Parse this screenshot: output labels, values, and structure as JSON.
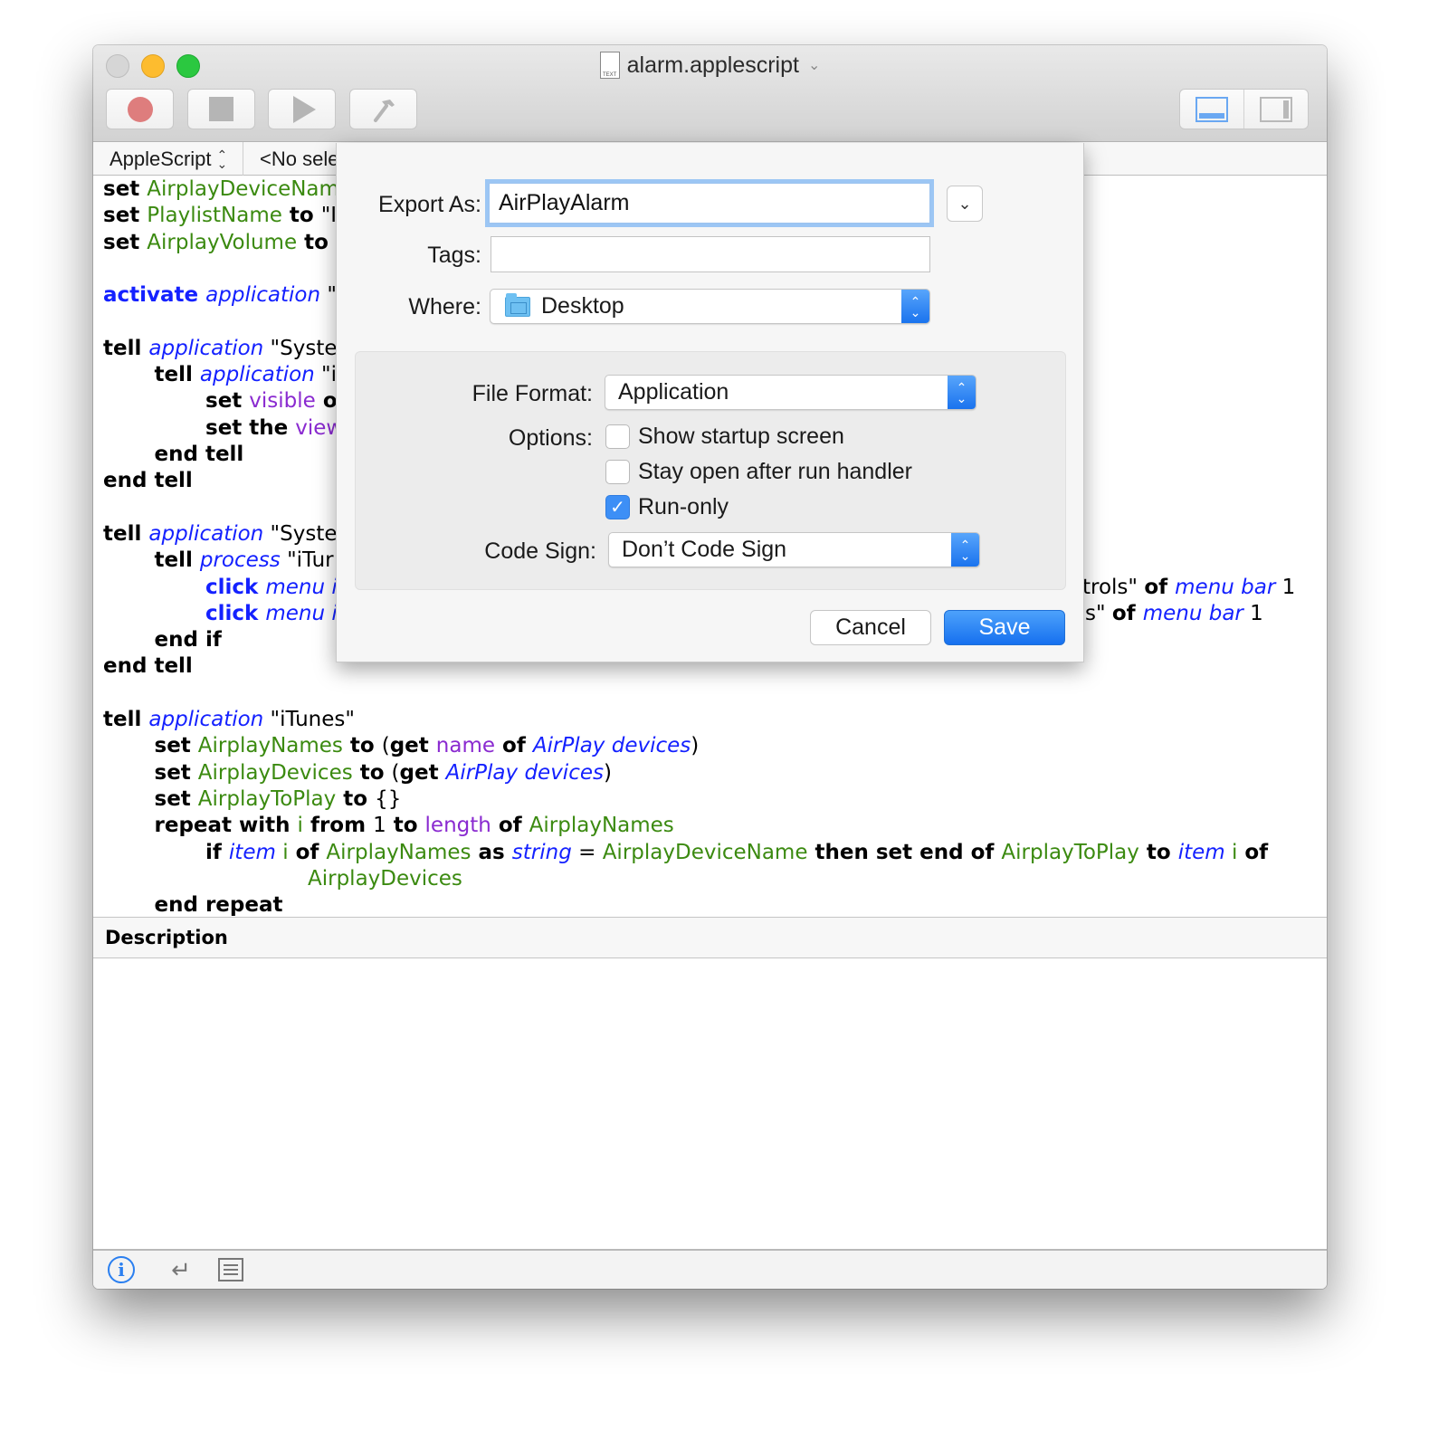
{
  "window": {
    "title": "alarm.applescript",
    "doc_icon_label": "TEXT",
    "title_chevron": "⌄"
  },
  "toolbar": {
    "record_icon": "record-icon",
    "stop_icon": "stop-icon",
    "run_icon": "play-icon",
    "compile_icon": "hammer-icon",
    "view_toggle": [
      "bottom-pane-icon",
      "side-pane-icon"
    ]
  },
  "navbar": {
    "language": "AppleScript",
    "selection": "<No sele",
    "updown": "⌃⌄"
  },
  "editor": {
    "lines": [
      [
        [
          "kw",
          "set "
        ],
        [
          "var",
          "AirplayDeviceNam"
        ]
      ],
      [
        [
          "kw",
          "set "
        ],
        [
          "var",
          "PlaylistName"
        ],
        [
          "kw",
          " to "
        ],
        [
          "str",
          "\"I"
        ]
      ],
      [
        [
          "kw",
          "set "
        ],
        [
          "var",
          "AirplayVolume"
        ],
        [
          "kw",
          " to"
        ]
      ],
      [],
      [
        [
          "cmd",
          "activate "
        ],
        [
          "app",
          "application"
        ],
        [
          "str",
          " \""
        ]
      ],
      [],
      [
        [
          "kw",
          "tell "
        ],
        [
          "app",
          "application"
        ],
        [
          "str",
          " \"Syste"
        ]
      ],
      [
        [
          "str",
          "\t"
        ],
        [
          "kw",
          "tell "
        ],
        [
          "app",
          "application"
        ],
        [
          "str",
          " \"i"
        ]
      ],
      [
        [
          "str",
          "\t\t"
        ],
        [
          "kw",
          "set "
        ],
        [
          "prop",
          "visible"
        ],
        [
          "kw",
          " o"
        ]
      ],
      [
        [
          "str",
          "\t\t"
        ],
        [
          "kw",
          "set the "
        ],
        [
          "prop",
          "view"
        ]
      ],
      [
        [
          "str",
          "\t"
        ],
        [
          "kw",
          "end tell"
        ]
      ],
      [
        [
          "kw",
          "end tell"
        ]
      ],
      [],
      [
        [
          "kw",
          "tell "
        ],
        [
          "app",
          "application"
        ],
        [
          "str",
          " \"Syste"
        ]
      ],
      [
        [
          "str",
          "\t"
        ],
        [
          "kw",
          "tell "
        ],
        [
          "app",
          "process"
        ],
        [
          "str",
          " \"iTur"
        ]
      ],
      [
        [
          "str",
          "\t\t"
        ],
        [
          "cmd",
          "click "
        ],
        [
          "app",
          "menu i"
        ]
      ],
      [
        [
          "str",
          "\t\t"
        ],
        [
          "cmd",
          "click "
        ],
        [
          "app",
          "menu i"
        ]
      ],
      [
        [
          "str",
          "\t"
        ],
        [
          "kw",
          "end if"
        ]
      ],
      [
        [
          "kw",
          "end tell"
        ]
      ],
      [],
      [
        [
          "kw",
          "tell "
        ],
        [
          "app",
          "application"
        ],
        [
          "str",
          " \"iTunes\""
        ]
      ],
      [
        [
          "str",
          "\t"
        ],
        [
          "kw",
          "set "
        ],
        [
          "var",
          "AirplayNames"
        ],
        [
          "kw",
          " to "
        ],
        [
          "str",
          "("
        ],
        [
          "kw",
          "get "
        ],
        [
          "prop",
          "name"
        ],
        [
          "kw",
          " of "
        ],
        [
          "app",
          "AirPlay devices"
        ],
        [
          "str",
          ")"
        ]
      ],
      [
        [
          "str",
          "\t"
        ],
        [
          "kw",
          "set "
        ],
        [
          "var",
          "AirplayDevices"
        ],
        [
          "kw",
          " to "
        ],
        [
          "str",
          "("
        ],
        [
          "kw",
          "get "
        ],
        [
          "app",
          "AirPlay devices"
        ],
        [
          "str",
          ")"
        ]
      ],
      [
        [
          "str",
          "\t"
        ],
        [
          "kw",
          "set "
        ],
        [
          "var",
          "AirplayToPlay"
        ],
        [
          "kw",
          " to "
        ],
        [
          "str",
          "{}"
        ]
      ],
      [
        [
          "str",
          "\t"
        ],
        [
          "kw",
          "repeat with "
        ],
        [
          "var",
          "i"
        ],
        [
          "kw",
          " from "
        ],
        [
          "str",
          "1"
        ],
        [
          "kw",
          " to "
        ],
        [
          "prop",
          "length"
        ],
        [
          "kw",
          " of "
        ],
        [
          "var",
          "AirplayNames"
        ]
      ],
      [
        [
          "str",
          "\t\t"
        ],
        [
          "kw",
          "if "
        ],
        [
          "app",
          "item"
        ],
        [
          "str",
          " "
        ],
        [
          "var",
          "i"
        ],
        [
          "kw",
          " of "
        ],
        [
          "var",
          "AirplayNames"
        ],
        [
          "kw",
          " as "
        ],
        [
          "app",
          "string"
        ],
        [
          "str",
          " = "
        ],
        [
          "var",
          "AirplayDeviceName"
        ],
        [
          "kw",
          " then set end of "
        ],
        [
          "var",
          "AirplayToPlay"
        ],
        [
          "kw",
          " to "
        ],
        [
          "app",
          "item"
        ],
        [
          "str",
          " "
        ],
        [
          "var",
          "i"
        ],
        [
          "kw",
          " of"
        ]
      ],
      [
        [
          "str",
          "\t\t\t\t"
        ],
        [
          "var",
          "AirplayDevices"
        ]
      ],
      [
        [
          "str",
          "\t"
        ],
        [
          "kw",
          "end repeat"
        ]
      ]
    ],
    "right_fragments": [
      [
        [
          "str",
          "trols\" "
        ],
        [
          "kw",
          "of "
        ],
        [
          "app",
          "menu bar"
        ],
        [
          "str",
          " 1"
        ]
      ],
      [
        [
          "str",
          "s\" "
        ],
        [
          "kw",
          "of "
        ],
        [
          "app",
          "menu bar"
        ],
        [
          "str",
          " 1"
        ]
      ]
    ]
  },
  "description": {
    "header": "Description",
    "body": ""
  },
  "bottombar": {
    "icons": [
      "info-icon",
      "return-icon",
      "list-icon"
    ],
    "info_glyph": "i",
    "return_glyph": "↵"
  },
  "sheet": {
    "export_as_label": "Export As:",
    "export_as_value": "AirPlayAlarm",
    "expand_glyph": "⌄",
    "tags_label": "Tags:",
    "tags_value": "",
    "where_label": "Where:",
    "where_value": "Desktop",
    "file_format_label": "File Format:",
    "file_format_value": "Application",
    "options_label": "Options:",
    "options": [
      {
        "label": "Show startup screen",
        "checked": false
      },
      {
        "label": "Stay open after run handler",
        "checked": false
      },
      {
        "label": "Run-only",
        "checked": true
      }
    ],
    "code_sign_label": "Code Sign:",
    "code_sign_value": "Don’t Code Sign",
    "cancel_label": "Cancel",
    "save_label": "Save",
    "check_glyph": "✓",
    "stepper_up": "⌃",
    "stepper_down": "⌄"
  },
  "colors": {
    "accent": "#1a73ee",
    "keyword": "#000000",
    "variable": "#3b8a10",
    "application": "#1421ff",
    "property": "#8a2ad0"
  }
}
